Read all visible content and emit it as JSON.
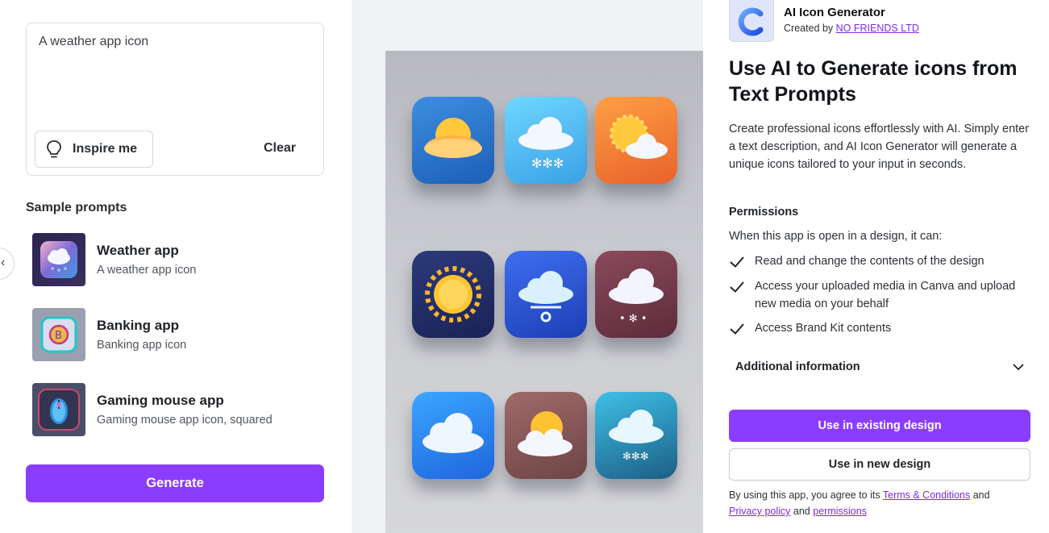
{
  "left": {
    "prompt_value": "A weather app icon",
    "inspire_label": "Inspire me",
    "clear_label": "Clear",
    "samples_title": "Sample prompts",
    "samples": [
      {
        "title": "Weather app",
        "subtitle": "A weather app icon"
      },
      {
        "title": "Banking app",
        "subtitle": "Banking app icon"
      },
      {
        "title": "Gaming mouse app",
        "subtitle": "Gaming mouse app icon, squared"
      }
    ],
    "generate_label": "Generate"
  },
  "preview": {
    "icons": [
      "sun-cloud",
      "cloud-snow",
      "sun-cloud",
      "sun",
      "cloud",
      "cloud-snow",
      "cloud",
      "sun-cloud",
      "cloud-snow"
    ]
  },
  "right": {
    "app_name": "AI Icon Generator",
    "created_by_prefix": "Created by",
    "creator_name": "NO FRIENDS LTD",
    "headline": "Use AI to Generate icons from Text Prompts",
    "description": "Create professional icons effortlessly with AI. Simply enter a text description, and AI Icon Generator will generate a unique icons tailored to your input in seconds.",
    "permissions_title": "Permissions",
    "permissions_intro": "When this app is open in a design, it can:",
    "permissions": [
      "Read and change the contents of the design",
      "Access your uploaded media in Canva and upload new media on your behalf",
      "Access Brand Kit contents"
    ],
    "additional_info": "Additional information",
    "use_existing_label": "Use in existing design",
    "use_new_label": "Use in new design",
    "legal_prefix": "By using this app, you agree to its",
    "terms_label": "Terms & Conditions",
    "legal_and": "and",
    "privacy_label": "Privacy policy",
    "legal_and2": "and",
    "permissions_link": "permissions",
    "accent": "#8b3dff"
  }
}
